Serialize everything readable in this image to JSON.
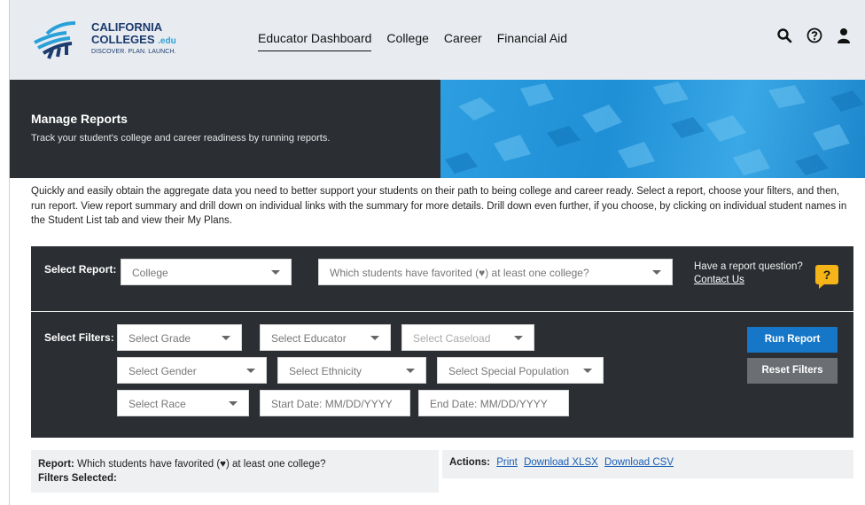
{
  "brand": {
    "line1": "CALIFORNIA",
    "line2": "COLLEGES",
    "edu": ".edu",
    "tagline": "DISCOVER. PLAN. LAUNCH."
  },
  "nav": {
    "items": [
      "Educator Dashboard",
      "College",
      "Career",
      "Financial Aid"
    ],
    "active": "Educator Dashboard"
  },
  "header_icons": [
    "search-icon",
    "help-icon",
    "user-icon"
  ],
  "banner": {
    "title": "Manage Reports",
    "subtitle": "Track your student's college and career readiness by running reports."
  },
  "intro": "Quickly and easily obtain the aggregate data you need to better support your students on their path to being college and career ready. Select a report, choose your filters, and then, run report. View report summary and drill down on individual links with the summary for more details. Drill down even further, if you choose, by clicking on individual student names in the Student List tab and view their My Plans.",
  "report": {
    "label": "Select Report:",
    "category_value": "College",
    "question_value": "Which students have favorited (♥) at least one college?",
    "help_text": "Have a report question?",
    "contact_link": "Contact Us",
    "help_badge": "?"
  },
  "filters": {
    "label": "Select Filters:",
    "grade": "Select Grade",
    "educator": "Select Educator",
    "caseload": "Select Caseload",
    "gender": "Select Gender",
    "ethnicity": "Select Ethnicity",
    "special_population": "Select Special Population",
    "race": "Select Race",
    "start_date_placeholder": "Start Date: MM/DD/YYYY",
    "end_date_placeholder": "End Date: MM/DD/YYYY",
    "run_button": "Run Report",
    "reset_button": "Reset Filters"
  },
  "summary": {
    "report_label": "Report:",
    "report_value": "Which students have favorited (♥) at least one college?",
    "filters_label": "Filters Selected:"
  },
  "actions": {
    "label": "Actions:",
    "print": "Print",
    "xlsx": "Download XLSX",
    "csv": "Download CSV"
  },
  "colors": {
    "dark_panel": "#2b2e33",
    "primary_button": "#1677c8",
    "secondary_button": "#6b6e73",
    "help_badge": "#f5b518",
    "brand_navy": "#1c3b6e",
    "brand_blue": "#2aa0d8"
  }
}
